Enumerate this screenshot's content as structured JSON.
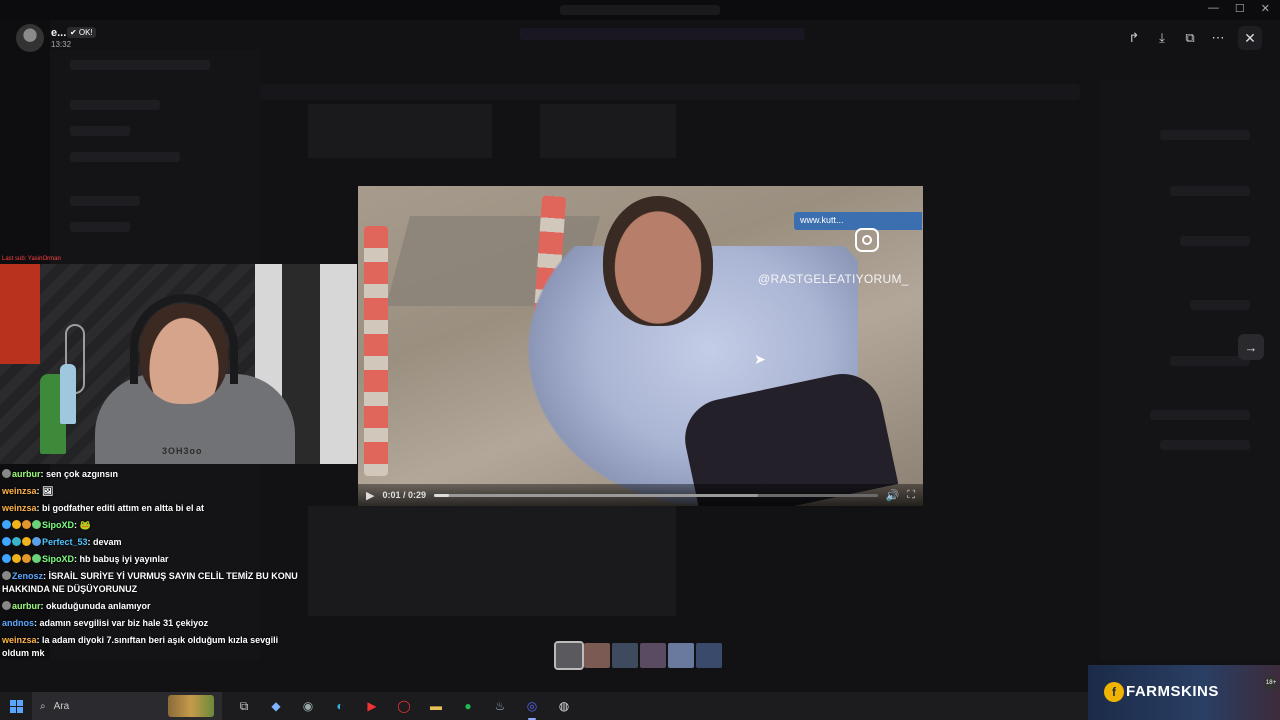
{
  "viewer": {
    "user_name": "e...",
    "badge": "✔ OK!",
    "time": "13:32"
  },
  "header_icons": [
    "share-icon",
    "download-icon",
    "open-external-icon",
    "more-icon"
  ],
  "video": {
    "instagram_handle": "@RASTGELEATIYORUM_",
    "tv_logo": "www.kutt...",
    "time_display": "0:01 / 0:29",
    "progress_fraction": 0.034,
    "buffered_fraction": 0.73
  },
  "webcam": {
    "last_sub": "Last sub: YasinOrman",
    "shirt_text": "3OH3oo"
  },
  "chat": [
    {
      "user": "aurbur",
      "color": "#9cff7a",
      "badges": [
        "#888"
      ],
      "text": "sen çok azgınsın"
    },
    {
      "user": "weinzsa",
      "color": "#ffb347",
      "badges": [],
      "text": "🖼"
    },
    {
      "user": "weinzsa",
      "color": "#ffb347",
      "badges": [],
      "text": "bi godfather editi attım en altta bi el at"
    },
    {
      "user": "SipoXD",
      "color": "#7dff7d",
      "badges": [
        "#3ea6ff",
        "#f2b21b",
        "#e2962c",
        "#6ad37a"
      ],
      "text": "🐸"
    },
    {
      "user": "Perfect_53",
      "color": "#4ec4ff",
      "badges": [
        "#3ea6ff",
        "#3bb3c8",
        "#f2b21b",
        "#5aa0e8"
      ],
      "text": "devam"
    },
    {
      "user": "SipoXD",
      "color": "#7dff7d",
      "badges": [
        "#3ea6ff",
        "#f2b21b",
        "#e2962c",
        "#6ad37a"
      ],
      "text": "hb babuş iyi yayınlar"
    },
    {
      "user": "Zenosz",
      "color": "#5aa8ff",
      "badges": [
        "#888"
      ],
      "text": "İSRAİL SURİYE Yİ VURMUŞ SAYIN CELİL TEMİZ BU KONU HAKKINDA NE DÜŞÜYORUNUZ"
    },
    {
      "user": "aurbur",
      "color": "#9cff7a",
      "badges": [
        "#888"
      ],
      "text": "okuduğunuda anlamıyor"
    },
    {
      "user": "andnos",
      "color": "#5aa8ff",
      "badges": [],
      "text": "adamın sevgilisi var biz hale 31 çekiyoz"
    },
    {
      "user": "weinzsa",
      "color": "#ffb347",
      "badges": [],
      "text": "la adam diyoki 7.sınıftan beri aşık olduğum kızla sevgili oldum mk"
    }
  ],
  "thumbnails": [
    {
      "color": "#5a5a5e",
      "active": true
    },
    {
      "color": "#7a5a52",
      "active": false
    },
    {
      "color": "#3e4a5e",
      "active": false
    },
    {
      "color": "#5a4a62",
      "active": false
    },
    {
      "color": "#6a7a9e",
      "active": false
    },
    {
      "color": "#3a4a6a",
      "active": false
    }
  ],
  "ad": {
    "brand": "FARMSKINS",
    "age": "18+"
  },
  "taskbar": {
    "search_placeholder": "Ara",
    "apps": [
      "task-view-icon",
      "copilot-icon",
      "app-icon",
      "edge-icon",
      "youtube-icon",
      "opera-icon",
      "explorer-icon",
      "spotify-icon",
      "steam-icon",
      "discord-icon",
      "obs-icon"
    ]
  },
  "colors": {
    "accent": "#5865f2",
    "overlay": "#0b0b0d"
  }
}
